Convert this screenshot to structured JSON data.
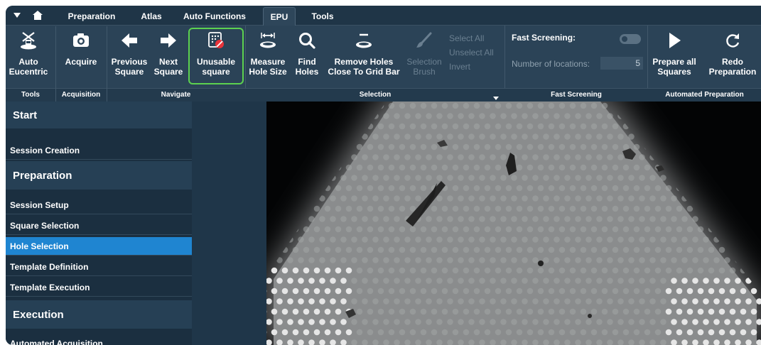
{
  "tabbar": {
    "tabs": [
      {
        "label": "Preparation"
      },
      {
        "label": "Atlas"
      },
      {
        "label": "Auto Functions"
      },
      {
        "label": "EPU"
      },
      {
        "label": "Tools"
      }
    ],
    "active_tab": "EPU"
  },
  "ribbon": {
    "buttons": [
      {
        "line1": "Auto",
        "line2": "Eucentric",
        "icon": "eucentric-icon"
      },
      {
        "line1": "Acquire",
        "line2": "",
        "icon": "camera-icon"
      },
      {
        "line1": "Previous",
        "line2": "Square",
        "icon": "arrow-left-icon"
      },
      {
        "line1": "Next",
        "line2": "Square",
        "icon": "arrow-right-icon"
      },
      {
        "line1": "Unusable",
        "line2": "square",
        "icon": "unusable-square-icon"
      },
      {
        "line1": "Measure",
        "line2": "Hole Size",
        "icon": "measure-hole-icon"
      },
      {
        "line1": "Find",
        "line2": "Holes",
        "icon": "search-icon"
      },
      {
        "line1": "Remove Holes",
        "line2": "Close To Grid Bar",
        "icon": "remove-holes-icon"
      },
      {
        "line1": "Selection",
        "line2": "Brush",
        "icon": "brush-icon"
      },
      {
        "line1": "Prepare all",
        "line2": "Squares",
        "icon": "play-icon"
      },
      {
        "line1": "Redo",
        "line2": "Preparation",
        "icon": "redo-icon"
      }
    ],
    "selection_menu": [
      "Select All",
      "Unselect All",
      "Invert"
    ],
    "fast_screening": {
      "label": "Fast Screening:",
      "locations_label": "Number of locations:",
      "locations_value": "5"
    },
    "groups": [
      "Tools",
      "Acquisition",
      "Navigate",
      "Selection",
      "Fast Screening",
      "Automated Preparation"
    ]
  },
  "sidebar": {
    "sections": [
      {
        "title": "Start",
        "items": [
          "Session Creation"
        ]
      },
      {
        "title": "Preparation",
        "items": [
          "Session Setup",
          "Square Selection",
          "Hole Selection",
          "Template Definition",
          "Template Execution"
        ]
      },
      {
        "title": "Execution",
        "items": [
          "Automated Acquisition"
        ]
      }
    ],
    "active_item": "Hole Selection"
  },
  "colors": {
    "highlight": "#5cd14f",
    "active_item": "#1f85d1",
    "panel": "#1e3346"
  }
}
